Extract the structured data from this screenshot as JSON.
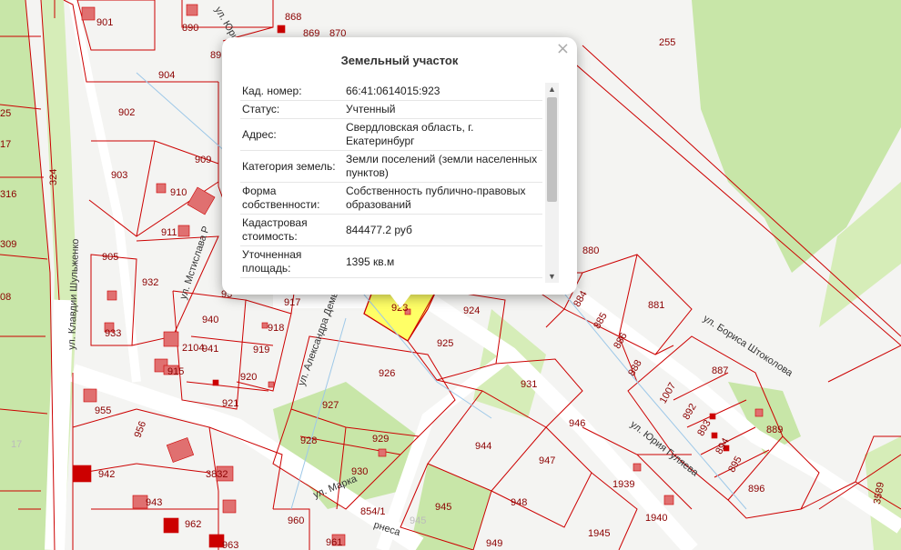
{
  "popup": {
    "title": "Земельный участок",
    "close_label": "×",
    "rows": [
      {
        "key": "Кад. номер:",
        "value": "66:41:0614015:923"
      },
      {
        "key": "Статус:",
        "value": "Учтенный"
      },
      {
        "key": "Адрес:",
        "value": "Свердловская область, г. Екатеринбург"
      },
      {
        "key": "Категория земель:",
        "value": "Земли поселений (земли населенных пунктов)"
      },
      {
        "key": "Форма собственности:",
        "value": "Собственность публично-правовых образований"
      },
      {
        "key": "Кадастровая стоимость:",
        "value": "844477.2 руб"
      },
      {
        "key": "Уточненная площадь:",
        "value": "1395 кв.м"
      }
    ]
  },
  "map": {
    "streets": {
      "s1": "ул. Клавдии Шульженко",
      "s2": "ул. Мстислава Р",
      "s3": "ул. Александра Демьяне",
      "s4": "ул. Бориса Штоколова",
      "s5": "ул. Юрия Гуляева",
      "s6": "ул. Марка",
      "s7": "рнеса",
      "s8": "ул. Юрия Гуляева"
    },
    "plots": {
      "p901": "901",
      "p890": "890",
      "p868": "868",
      "p869": "869",
      "p870": "870",
      "p89": "89",
      "p904": "904",
      "p902": "902",
      "p909": "909",
      "p903": "903",
      "p910": "910",
      "p911": "911",
      "p905": "905",
      "p932": "932",
      "p933": "933",
      "p940": "940",
      "p941": "941",
      "p2104": "2104",
      "p915": "915",
      "p920": "920",
      "p921": "921",
      "p918": "918",
      "p919": "919",
      "p917": "917",
      "p93": "93",
      "p923": "923",
      "p924": "924",
      "p925": "925",
      "p926": "926",
      "p927": "927",
      "p928": "928",
      "p929": "929",
      "p930": "930",
      "p931": "931",
      "p944": "944",
      "p946": "946",
      "p947": "947",
      "p948": "948",
      "p945": "945",
      "p949": "949",
      "p955": "955",
      "p956": "956",
      "p942": "942",
      "p943": "943",
      "p3832": "3832",
      "p962": "962",
      "p963": "963",
      "p960": "960",
      "p961": "961",
      "p8541": "854/1",
      "p945b": "945",
      "p880": "880",
      "p884": "884",
      "p885": "885",
      "p886": "886",
      "p888": "888",
      "p881": "881",
      "p887": "887",
      "p1007": "1007",
      "p892": "892",
      "p893": "893",
      "p894": "894",
      "p895": "895",
      "p896": "896",
      "p889": "889",
      "p1939": "1939",
      "p1940": "1940",
      "p1945": "1945",
      "p3589": "3589",
      "p255": "255",
      "p324": "324",
      "p316": "316",
      "p309": "309",
      "p08": "08",
      "p17": "17",
      "p25": "25",
      "p17b": "17"
    }
  },
  "colors": {
    "boundary": "#cc0000",
    "selected_fill": "#ffff66",
    "vegetation": "#c8e6a8",
    "road": "#ffffff"
  }
}
